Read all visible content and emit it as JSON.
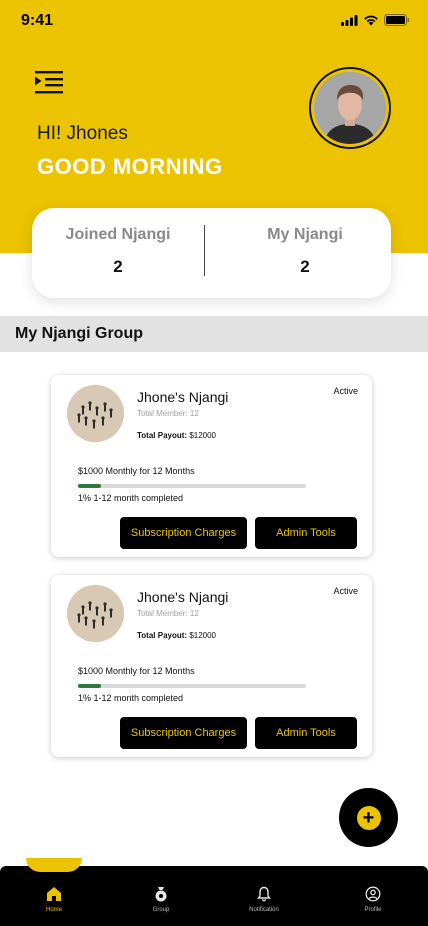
{
  "status_bar": {
    "time": "9:41"
  },
  "header": {
    "greeting_name": "HI! Jhones",
    "greeting_time": "GOOD MORNING"
  },
  "stats": {
    "joined_label": "Joined Njangi",
    "joined_value": "2",
    "my_label": "My Njangi",
    "my_value": "2"
  },
  "section": {
    "title": "My Njangi Group"
  },
  "groups": [
    {
      "name": "Jhone's Njangi",
      "members": "Total Member: 12",
      "payout_label": "Total Payout:",
      "payout_value": "$12000",
      "status": "Active",
      "plan": "$1000 Monthly for 12 Months",
      "progress_text": "1% 1-12 month completed",
      "progress": 0.1,
      "subscription_label": "Subscription Charges",
      "admin_label": "Admin Tools"
    },
    {
      "name": "Jhone's Njangi",
      "members": "Total Member: 12",
      "payout_label": "Total Payout:",
      "payout_value": "$12000",
      "status": "Active",
      "plan": "$1000 Monthly for 12 Months",
      "progress_text": "1% 1-12 month completed",
      "progress": 0.1,
      "subscription_label": "Subscription Charges",
      "admin_label": "Admin Tools"
    }
  ],
  "fab": {
    "icon": "plus-icon"
  },
  "nav": [
    {
      "label": "Home",
      "icon": "home-icon",
      "active": true
    },
    {
      "label": "Group",
      "icon": "money-bag-icon",
      "active": false
    },
    {
      "label": "Notification",
      "icon": "bell-icon",
      "active": false
    },
    {
      "label": "Profile",
      "icon": "user-circle-icon",
      "active": false
    }
  ],
  "colors": {
    "accent": "#EBC300",
    "dark": "#000000",
    "progress": "#2E7A3E"
  }
}
